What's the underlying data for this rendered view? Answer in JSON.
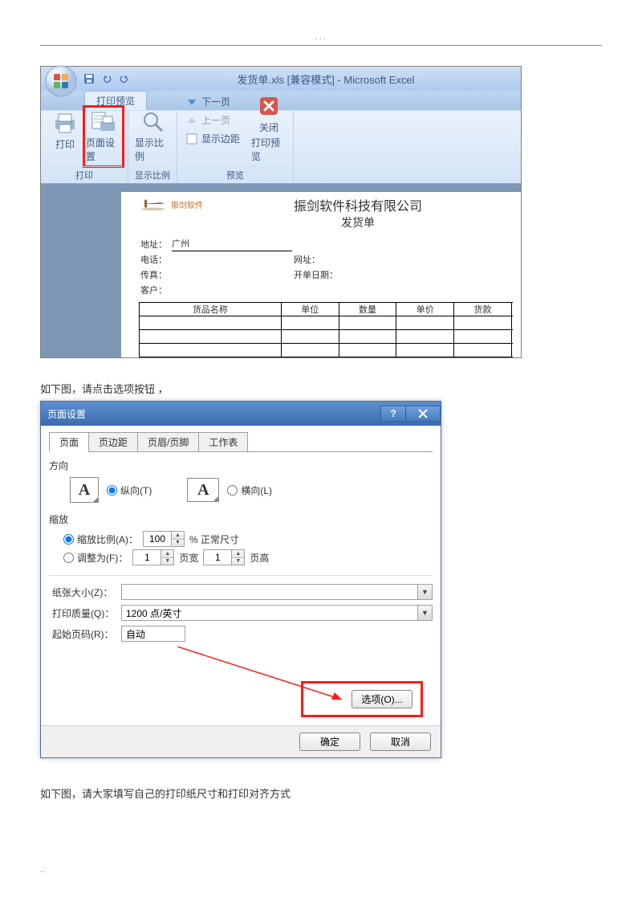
{
  "header_dots": "...",
  "excel": {
    "title": "发货单.xls [兼容模式] - Microsoft Excel",
    "tab": "打印预览",
    "ribbon": {
      "print_group_label": "打印",
      "print_btn": "打印",
      "page_setup_btn": "页面设置",
      "zoom_group_label": "显示比例",
      "zoom_btn": "显示比例",
      "preview_group_label": "预览",
      "next_page": "下一页",
      "prev_page": "上一页",
      "show_margins": "显示边距",
      "close_btn_l1": "关闭",
      "close_btn_l2": "打印预览"
    },
    "doc": {
      "logo_text": "振剑软件",
      "company": "振剑软件科技有限公司",
      "subtitle": "发货单",
      "fields": {
        "addr_label": "地址：",
        "addr_val": "广州",
        "tel_label": "电话：",
        "fax_label": "传真：",
        "cust_label": "客户：",
        "url_label": "网址：",
        "date_label": "开单日期："
      },
      "columns": [
        "货品名称",
        "单位",
        "数量",
        "单价",
        "货款"
      ]
    }
  },
  "instr1": "如下图，请点击选项按钮 ，",
  "dialog": {
    "title": "页面设置",
    "tabs": [
      "页面",
      "页边距",
      "页眉/页脚",
      "工作表"
    ],
    "orientation_label": "方向",
    "portrait": "纵向(T)",
    "landscape": "横向(L)",
    "scale_label": "缩放",
    "scale_ratio": "缩放比例(A)：",
    "scale_ratio_val": "100",
    "scale_ratio_suffix": "% 正常尺寸",
    "fit_to": "调整为(F)：",
    "fit_w": "1",
    "fit_w_suffix": "页宽",
    "fit_h": "1",
    "fit_h_suffix": "页高",
    "paper_size": "纸张大小(Z)：",
    "print_quality": "打印质量(Q)：",
    "print_quality_val": "1200 点/英寸",
    "first_page": "起始页码(R)：",
    "first_page_val": "自动",
    "options_btn": "选项(O)...",
    "ok": "确定",
    "cancel": "取消"
  },
  "instr2": "如下图，请大家填写自己的打印纸尺寸和打印对齐方式",
  "footer_dots": ".."
}
